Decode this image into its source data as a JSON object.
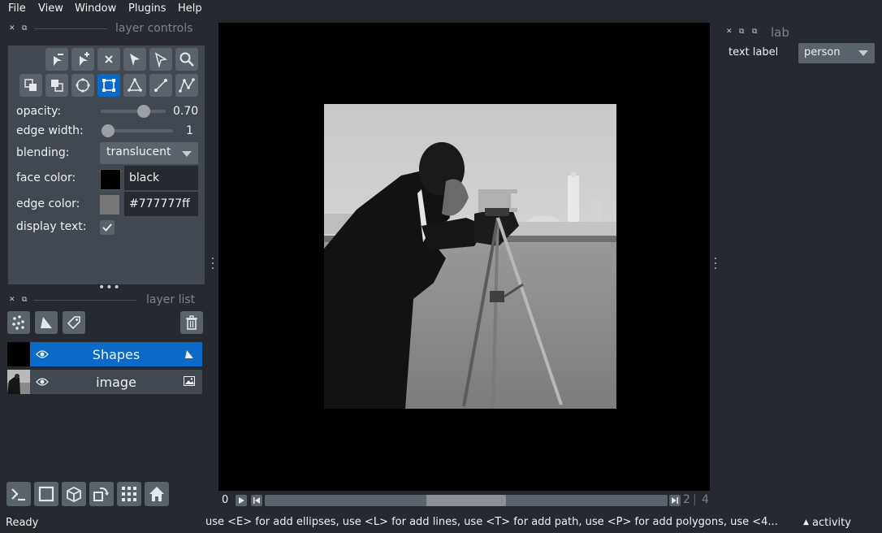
{
  "menubar": {
    "items": [
      "File",
      "View",
      "Window",
      "Plugins",
      "Help"
    ]
  },
  "layer_controls": {
    "title": "layer controls",
    "opacity": {
      "label": "opacity:",
      "value": "0.70",
      "fraction": 0.7
    },
    "edge_width": {
      "label": "edge width:",
      "value": "1",
      "fraction": 0.0
    },
    "blending": {
      "label": "blending:",
      "value": "translucent"
    },
    "face_color": {
      "label": "face color:",
      "value": "black",
      "swatch": "#000000"
    },
    "edge_color": {
      "label": "edge color:",
      "value": "#777777ff",
      "swatch": "#777777"
    },
    "display_text": {
      "label": "display text:",
      "checked": true
    }
  },
  "layer_list": {
    "title": "layer list",
    "layers": [
      {
        "name": "Shapes",
        "selected": true,
        "type_icon": "shapes-icon"
      },
      {
        "name": "image",
        "selected": false,
        "type_icon": "image-icon"
      }
    ]
  },
  "dims": {
    "current": "0",
    "slider_fraction": 0.5,
    "left_value": "2",
    "right_value": "4"
  },
  "right_dock": {
    "title": "lab",
    "text_label": {
      "label": "text label",
      "value": "person"
    }
  },
  "status": {
    "ready": "Ready",
    "hint": "use <E> for add ellipses, use <L> for add lines, use <T> for add path, use <P> for add polygons, use <4...",
    "activity": "activity"
  },
  "colors": {
    "accent": "#0b69c7",
    "background": "#262930",
    "panel": "#414851",
    "button": "#5a626c"
  }
}
